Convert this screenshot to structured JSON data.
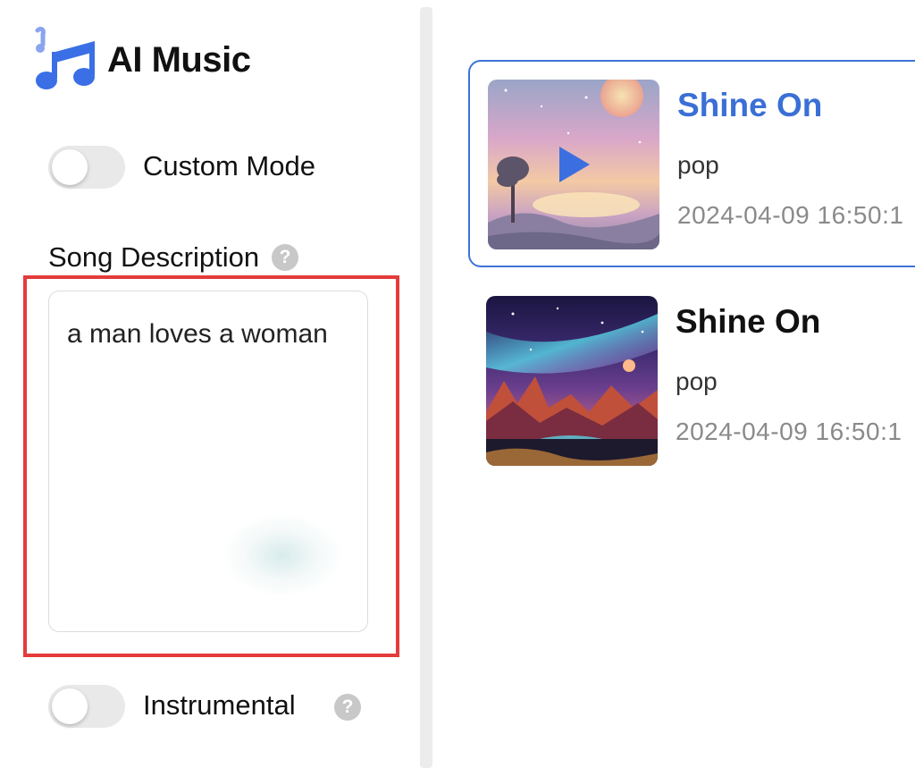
{
  "app": {
    "title": "AI Music",
    "logo_icon": "music-note-icon",
    "accent_color": "#3a6fd6"
  },
  "sidebar": {
    "custom_mode": {
      "label": "Custom Mode",
      "enabled": false
    },
    "song_description": {
      "label": "Song Description",
      "value": "a man loves a woman",
      "help_icon": "question-icon"
    },
    "instrumental": {
      "label": "Instrumental",
      "enabled": false,
      "help_icon": "question-icon"
    }
  },
  "songs": [
    {
      "title": "Shine On",
      "genre": "pop",
      "date": "2024-04-09 16:50:1",
      "selected": true,
      "playing_icon": "play-icon"
    },
    {
      "title": "Shine On",
      "genre": "pop",
      "date": "2024-04-09 16:50:1",
      "selected": false
    }
  ]
}
